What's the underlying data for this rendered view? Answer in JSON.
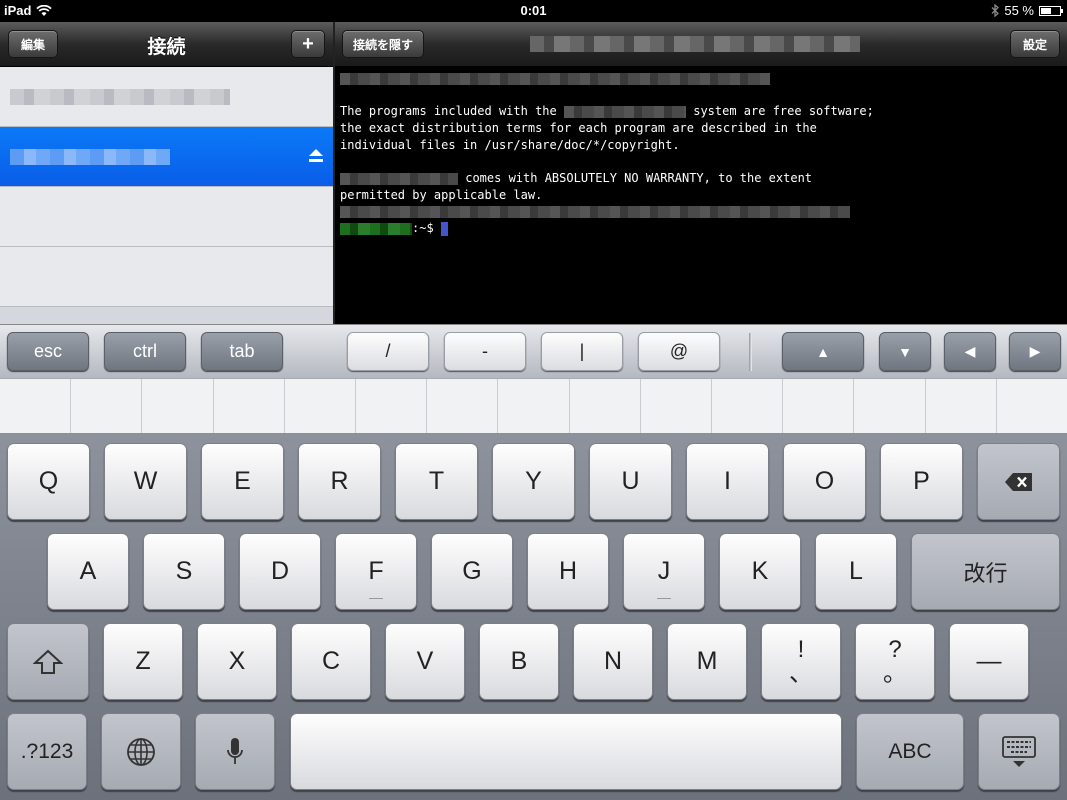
{
  "status_bar": {
    "device": "iPad",
    "time": "0:01",
    "battery": "55 %",
    "battery_level": 0.55
  },
  "left_pane": {
    "edit_button": "編集",
    "title": "接続",
    "add_button": "+"
  },
  "right_pane": {
    "hide_button": "接続を隠す",
    "settings_button": "設定"
  },
  "terminal": {
    "line2a": "The programs included with the",
    "line2b": "system are free software;",
    "line3": "the exact distribution terms for each program are described in the",
    "line4": "individual files in /usr/share/doc/*/copyright.",
    "line6b": "comes with ABSOLUTELY NO WARRANTY, to the extent",
    "line7": "permitted by applicable law.",
    "prompt_suffix": ":~$"
  },
  "accessory_keys": {
    "esc": "esc",
    "ctrl": "ctrl",
    "tab": "tab",
    "slash": "/",
    "dash": "-",
    "pipe": "|",
    "at": "@",
    "up": "▲",
    "down": "▼",
    "left": "◀",
    "right": "▶"
  },
  "keyboard": {
    "row1": [
      "Q",
      "W",
      "E",
      "R",
      "T",
      "Y",
      "U",
      "I",
      "O",
      "P"
    ],
    "row2": [
      "A",
      "S",
      "D",
      "F",
      "G",
      "H",
      "J",
      "K",
      "L"
    ],
    "return": "改行",
    "row3": [
      "Z",
      "X",
      "C",
      "V",
      "B",
      "N",
      "M"
    ],
    "punct1_top": "!",
    "punct1_bottom": "、",
    "punct2_top": "?",
    "punct2_bottom": "。",
    "dash": "—",
    "numbers": ".?123",
    "abc": "ABC"
  }
}
